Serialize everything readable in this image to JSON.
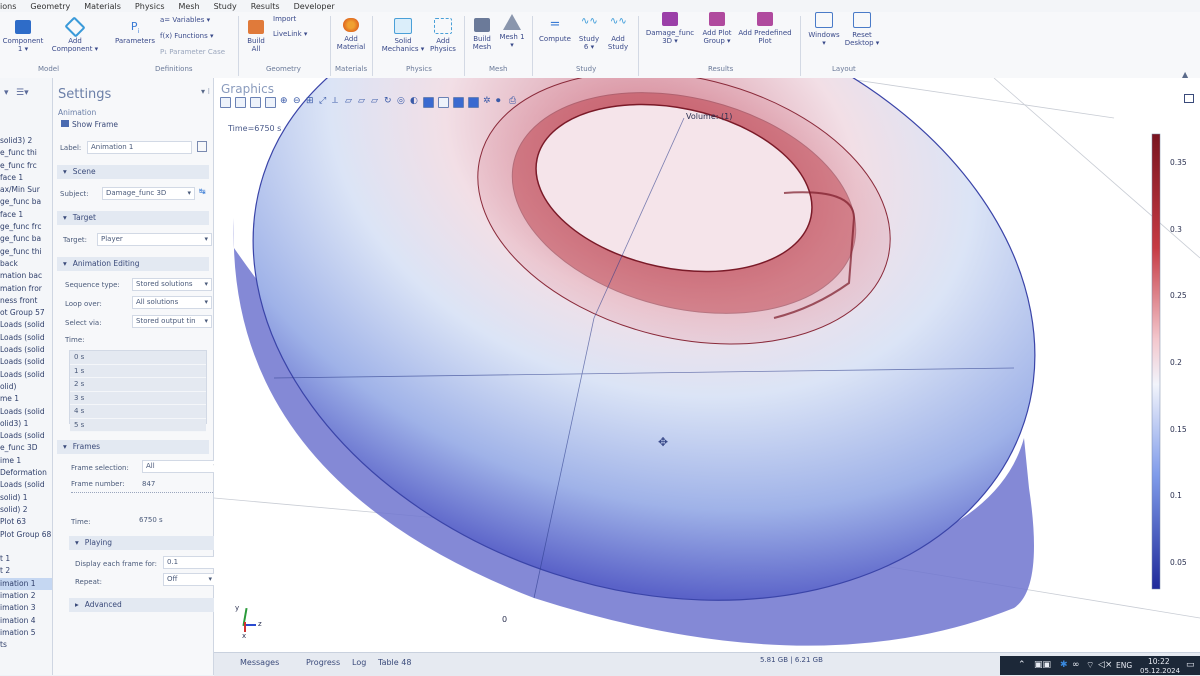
{
  "menubar": {
    "items": [
      "ions",
      "Geometry",
      "Materials",
      "Physics",
      "Mesh",
      "Study",
      "Results",
      "Developer"
    ]
  },
  "ribbon": {
    "buttons": [
      {
        "name": "component",
        "label": "Component 1 ▾"
      },
      {
        "name": "add-component",
        "label": "Add Component ▾"
      },
      {
        "name": "parameters",
        "label": "Parameters"
      },
      {
        "name": "variables",
        "label": "a= Variables ▾"
      },
      {
        "name": "functions",
        "label": "f(x) Functions ▾"
      },
      {
        "name": "parameter-case",
        "label": "P₁ Parameter Case"
      },
      {
        "name": "build-all",
        "label": "Build All"
      },
      {
        "name": "import",
        "label": "Import"
      },
      {
        "name": "livelink",
        "label": "LiveLink ▾"
      },
      {
        "name": "add-material",
        "label": "Add Material"
      },
      {
        "name": "solid-mechanics",
        "label": "Solid Mechanics ▾"
      },
      {
        "name": "add-physics",
        "label": "Add Physics"
      },
      {
        "name": "build-mesh",
        "label": "Build Mesh"
      },
      {
        "name": "mesh",
        "label": "Mesh 1 ▾"
      },
      {
        "name": "compute",
        "label": "Compute"
      },
      {
        "name": "study",
        "label": "Study 6 ▾"
      },
      {
        "name": "add-study",
        "label": "Add Study"
      },
      {
        "name": "damage-func",
        "label": "Damage_func 3D ▾"
      },
      {
        "name": "add-plot-group",
        "label": "Add Plot Group ▾"
      },
      {
        "name": "add-predefined-plot",
        "label": "Add Predefined Plot"
      },
      {
        "name": "windows",
        "label": "Windows ▾"
      },
      {
        "name": "reset-desktop",
        "label": "Reset Desktop ▾"
      }
    ],
    "groups": [
      "Model",
      "Definitions",
      "Geometry",
      "Materials",
      "Physics",
      "Mesh",
      "Study",
      "Results",
      "Layout"
    ]
  },
  "tree": {
    "items": [
      "solid3) 2",
      "e_func thi",
      "e_func frc",
      "face 1",
      "ax/Min Sur",
      "ge_func ba",
      "face 1",
      "ge_func frc",
      "ge_func ba",
      "ge_func thi",
      "back",
      "mation bac",
      "mation fror",
      "ness front",
      "ot Group 57",
      "Loads (solid",
      "Loads (solid",
      "Loads (solid",
      "Loads (solid",
      "Loads (solid",
      "olid)",
      "me 1",
      "Loads (solid",
      "olid3) 1",
      "Loads (solid",
      "e_func 3D",
      "ime 1",
      "Deformation",
      "Loads (solid",
      "solid) 1",
      "solid) 2",
      "Plot 63",
      "Plot Group 68",
      "",
      "t 1",
      "t 2",
      "imation 1",
      "imation 2",
      "imation 3",
      "imation 4",
      "imation 5",
      "ts"
    ],
    "selected_index": 36
  },
  "settings": {
    "title": "Settings",
    "subtitle": "Animation",
    "show_frame": "Show Frame",
    "label_caption": "Label:",
    "label_value": "Animation 1",
    "scene": {
      "header": "Scene",
      "subject_caption": "Subject:",
      "subject_value": "Damage_func 3D"
    },
    "target": {
      "header": "Target",
      "target_caption": "Target:",
      "target_value": "Player"
    },
    "editing": {
      "header": "Animation Editing",
      "sequence_caption": "Sequence type:",
      "sequence_value": "Stored solutions",
      "loop_caption": "Loop over:",
      "loop_value": "All solutions",
      "select_caption": "Select via:",
      "select_value": "Stored output tin",
      "time_caption": "Time:",
      "times": [
        "0 s",
        "1 s",
        "2 s",
        "3 s",
        "4 s",
        "5 s"
      ]
    },
    "frames": {
      "header": "Frames",
      "selection_caption": "Frame selection:",
      "selection_value": "All",
      "number_caption": "Frame number:",
      "number_value": "847",
      "time_caption": "Time:",
      "time_value": "6750 s"
    },
    "playing": {
      "header": "Playing",
      "display_caption": "Display each frame for:",
      "display_value": "0.1",
      "display_unit": "s",
      "repeat_caption": "Repeat:",
      "repeat_value": "Off"
    },
    "advanced": "Advanced"
  },
  "graphics": {
    "title": "Graphics",
    "time_label": "Time=6750 s",
    "volume_label": "Volume: (1)",
    "origin_label": "0",
    "axes": {
      "x": "x",
      "y": "y",
      "z": "z"
    },
    "colorbar_ticks": [
      "0.35",
      "0.3",
      "0.25",
      "0.2",
      "0.15",
      "0.1",
      "0.05"
    ]
  },
  "bottom": {
    "tabs": [
      "Messages",
      "Progress",
      "Log",
      "Table 48"
    ],
    "memory": "5.81 GB | 6.21 GB"
  },
  "taskbar": {
    "language": "ENG",
    "time": "10:22",
    "date": "05.12.2024"
  },
  "colors": {
    "accent": "#2f64c8",
    "hot": "#9e2230",
    "cold": "#2b36a8"
  }
}
